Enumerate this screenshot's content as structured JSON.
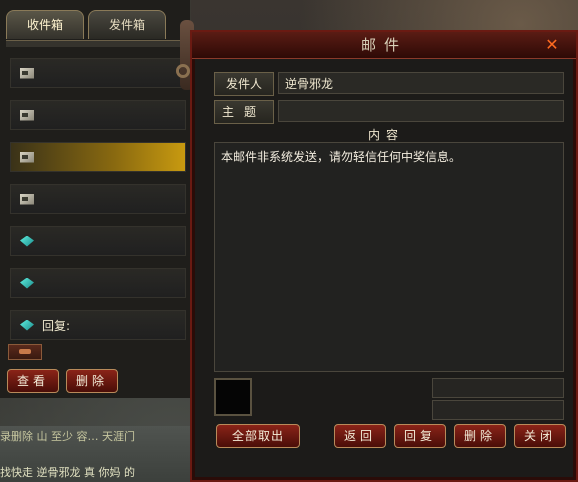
{
  "inbox": {
    "tabs": [
      {
        "label": "收件箱",
        "active": true
      },
      {
        "label": "发件箱",
        "active": false
      }
    ],
    "items": [
      {
        "icon": "read-mail-icon",
        "label": ""
      },
      {
        "icon": "read-mail-icon",
        "label": ""
      },
      {
        "icon": "read-mail-icon",
        "label": "",
        "selected": true
      },
      {
        "icon": "read-mail-icon",
        "label": ""
      },
      {
        "icon": "unread-mail-icon",
        "label": ""
      },
      {
        "icon": "unread-mail-icon",
        "label": ""
      },
      {
        "icon": "unread-mail-icon",
        "label": "回复:"
      }
    ],
    "view_label": "查看",
    "delete_label": "删除"
  },
  "mail": {
    "title": "邮件",
    "sender_label": "发件人",
    "sender_value": "逆骨邪龙",
    "subject_label": "主题",
    "subject_value": "",
    "content_label": "内容",
    "content_text": "本邮件非系统发送，请勿轻信任何中奖信息。",
    "buttons": {
      "take_all": "全部取出",
      "back": "返回",
      "reply": "回复",
      "delete": "删除",
      "close": "关闭"
    }
  },
  "chat": {
    "line1": "录删除  山  至少  容…  天涯门",
    "line2": "找快走 逆骨邪龙 真 你妈 的"
  },
  "colors": {
    "accent_red": "#8a2418",
    "selected_gold": "#c89a10",
    "unread_cyan": "#5ff0e0",
    "close_orange": "#ff6a20"
  }
}
